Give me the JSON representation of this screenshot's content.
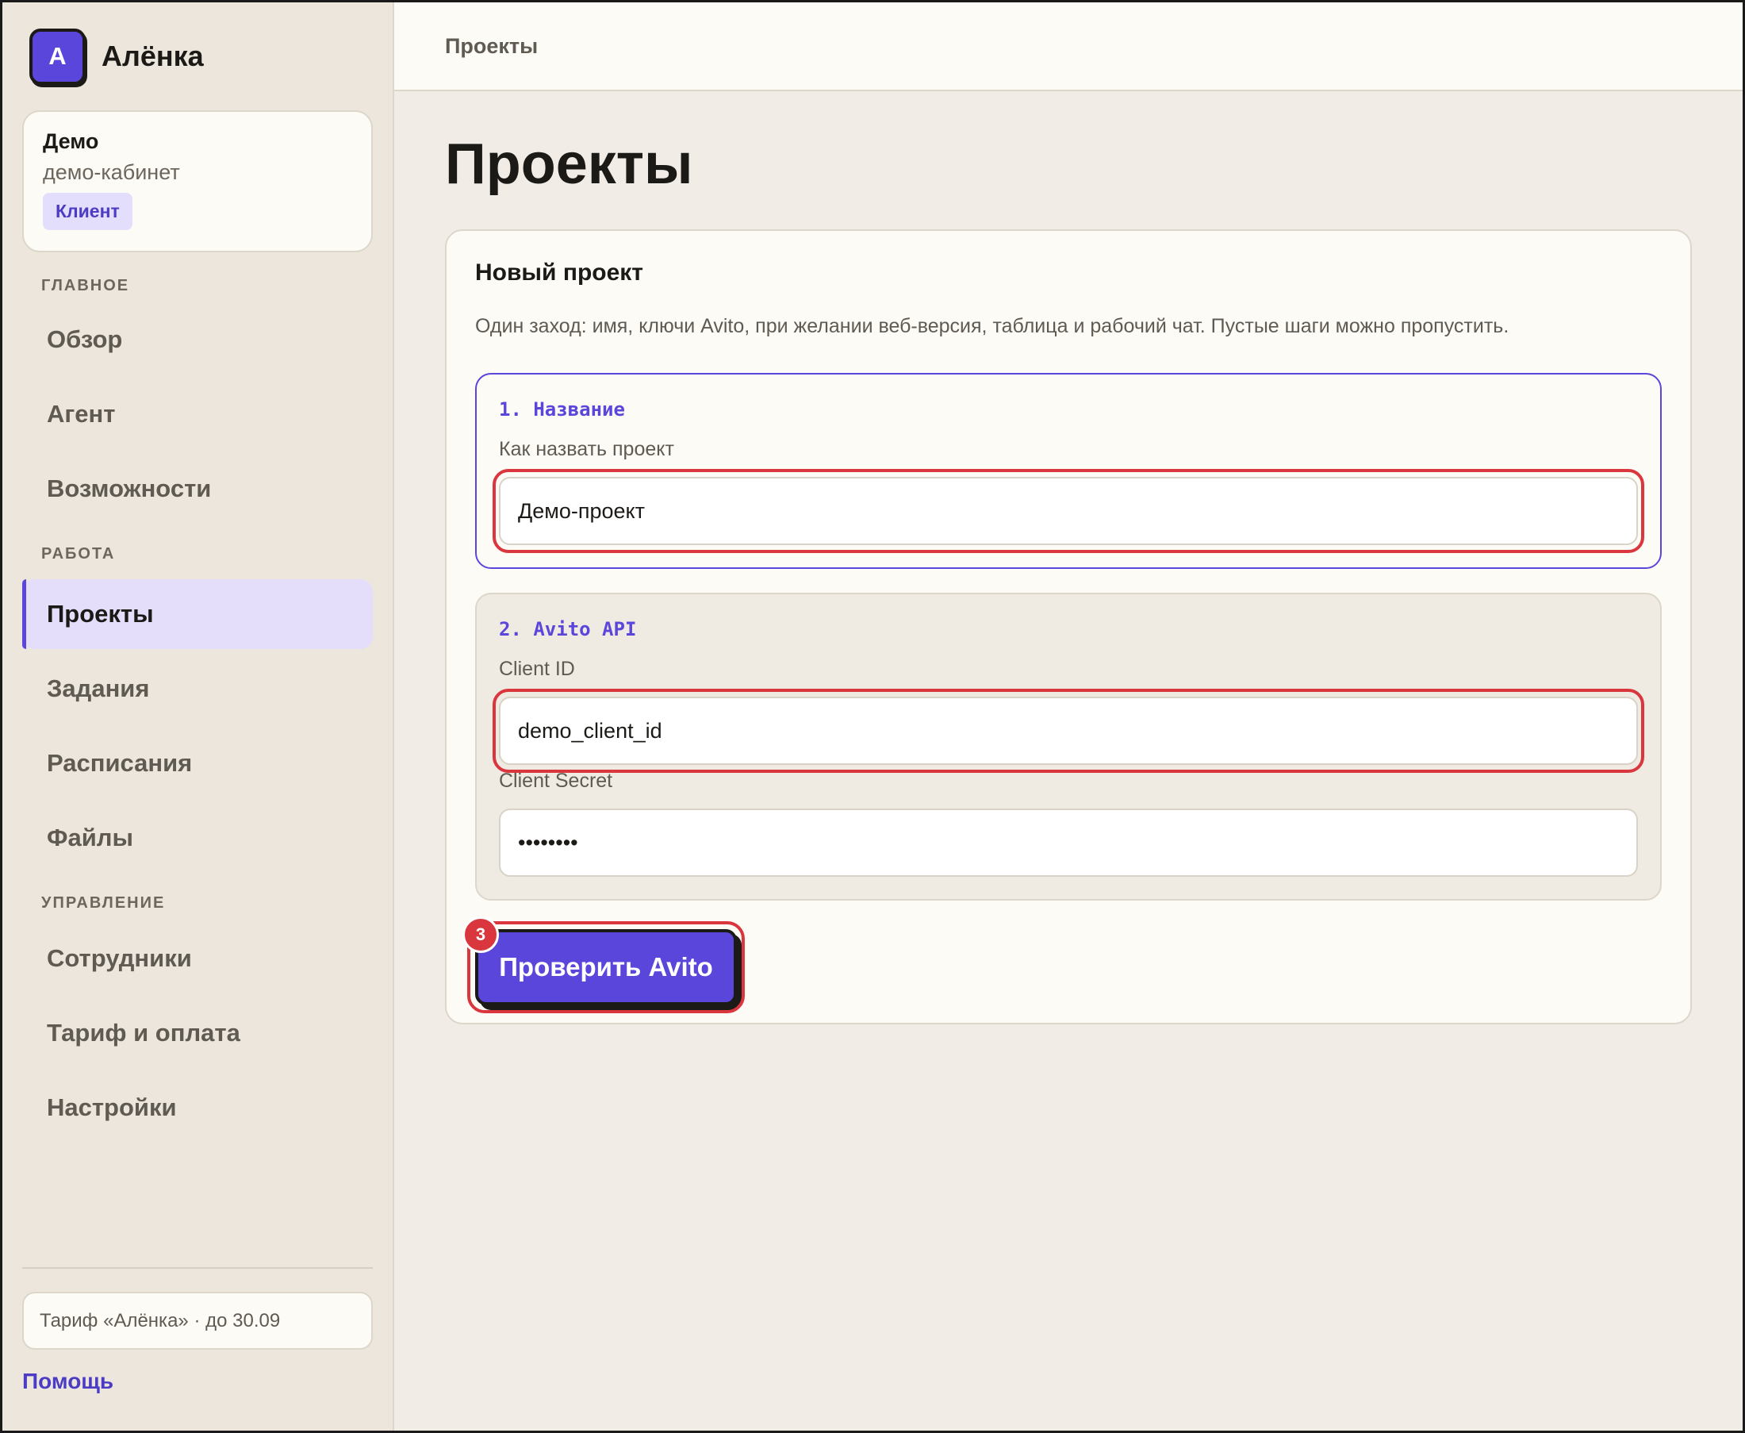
{
  "brand": {
    "logo_letter": "А",
    "name": "Алёнка",
    "accent": "#5b46dc"
  },
  "account": {
    "name": "Демо",
    "subtitle": "демо-кабинет",
    "role": "Клиент"
  },
  "nav": {
    "sections": [
      {
        "label": "ГЛАВНОЕ",
        "items": [
          "Обзор",
          "Агент",
          "Возможности"
        ]
      },
      {
        "label": "РАБОТА",
        "items": [
          "Проекты",
          "Задания",
          "Расписания",
          "Файлы"
        ]
      },
      {
        "label": "УПРАВЛЕНИЕ",
        "items": [
          "Сотрудники",
          "Тариф и оплата",
          "Настройки"
        ]
      }
    ],
    "active": "Проекты"
  },
  "sidebar_footer": {
    "plan": "Тариф «Алёнка» · до 30.09",
    "help": "Помощь"
  },
  "topbar": {
    "breadcrumb": "Проекты"
  },
  "page": {
    "title": "Проекты"
  },
  "card": {
    "title": "Новый проект",
    "description": "Один заход: имя, ключи Avito, при желании веб-версия, таблица и рабочий чат. Пустые шаги можно пропустить.",
    "step1": {
      "title": "1. Название",
      "label": "Как назвать проект",
      "value": "Демо-проект"
    },
    "step2": {
      "title": "2. Avito API",
      "client_id_label": "Client ID",
      "client_id_value": "demo_client_id",
      "client_secret_label": "Client Secret",
      "client_secret_value": "••••••••"
    },
    "button": {
      "label": "Проверить Avito",
      "badge": "3"
    }
  },
  "colors": {
    "highlight": "#d9363e",
    "active_nav_bg": "#e4defb"
  }
}
